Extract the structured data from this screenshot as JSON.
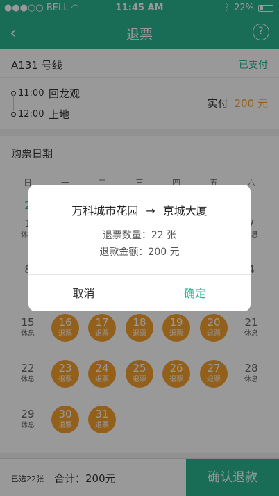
{
  "status_bar": {
    "carrier": "●●●○○ BELL",
    "time": "11:45 AM",
    "battery": "22%"
  },
  "navbar": {
    "back_icon": "‹",
    "title": "退票",
    "help_icon": "?"
  },
  "route": {
    "name": "A131 号线",
    "status": "已支付",
    "stops": [
      {
        "time": "11:00",
        "name": "回龙观"
      },
      {
        "time": "12:00",
        "name": "上地"
      }
    ],
    "paid_label": "实付",
    "paid_amount": "200 元"
  },
  "calendar": {
    "title": "购票日期",
    "weekdays": [
      "日",
      "一",
      "二",
      "三",
      "四",
      "五",
      "六"
    ],
    "row1_first": "2",
    "rows": [
      [
        {
          "num": "1",
          "tag": "休息",
          "kind": "rest"
        },
        null,
        null,
        null,
        null,
        null,
        {
          "num": "7",
          "tag": "休息",
          "kind": "rest"
        }
      ],
      [
        {
          "num": "8",
          "tag": "",
          "kind": "rest"
        },
        null,
        null,
        null,
        null,
        null,
        {
          "num": "4",
          "tag": "",
          "kind": "rest"
        }
      ],
      [
        {
          "num": "15",
          "tag": "休息",
          "kind": "rest"
        },
        {
          "num": "16",
          "tag": "退票",
          "kind": "refund"
        },
        {
          "num": "17",
          "tag": "退票",
          "kind": "refund"
        },
        {
          "num": "18",
          "tag": "退票",
          "kind": "refund"
        },
        {
          "num": "19",
          "tag": "退票",
          "kind": "refund"
        },
        {
          "num": "20",
          "tag": "退票",
          "kind": "refund"
        },
        {
          "num": "21",
          "tag": "休息",
          "kind": "rest"
        }
      ],
      [
        {
          "num": "22",
          "tag": "休息",
          "kind": "rest"
        },
        {
          "num": "23",
          "tag": "退票",
          "kind": "refund"
        },
        {
          "num": "24",
          "tag": "退票",
          "kind": "refund"
        },
        {
          "num": "25",
          "tag": "退票",
          "kind": "refund"
        },
        {
          "num": "26",
          "tag": "退票",
          "kind": "refund"
        },
        {
          "num": "27",
          "tag": "退票",
          "kind": "refund"
        },
        {
          "num": "28",
          "tag": "休息",
          "kind": "rest"
        }
      ],
      [
        {
          "num": "29",
          "tag": "休息",
          "kind": "rest"
        },
        {
          "num": "30",
          "tag": "退票",
          "kind": "refund"
        },
        {
          "num": "31",
          "tag": "退票",
          "kind": "refund"
        },
        null,
        null,
        null,
        null
      ]
    ]
  },
  "bottom": {
    "selected": "已选22张",
    "total": "合计：200元",
    "confirm": "确认退款"
  },
  "modal": {
    "from": "万科城市花园",
    "arrow": "→",
    "to": "京城大厦",
    "count_line": "退票数量：22 张",
    "amount_line": "退款金额：200 元",
    "cancel": "取消",
    "ok": "确定"
  },
  "colors": {
    "accent": "#2bb48f",
    "refund": "#f5a02d",
    "price": "#f0a030"
  }
}
